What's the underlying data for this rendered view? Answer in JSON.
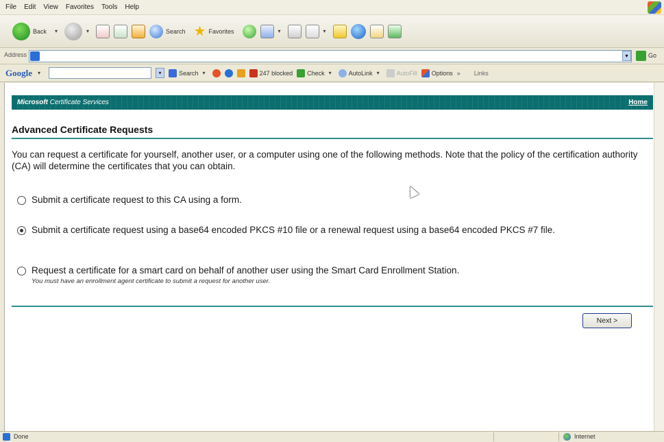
{
  "menu": [
    "File",
    "Edit",
    "View",
    "Favorites",
    "Tools",
    "Help"
  ],
  "toolbar": {
    "back_label": "Back",
    "search_label": "Search",
    "favorites_label": "Favorites"
  },
  "address": {
    "label": "Address",
    "value": "",
    "go_label": "Go"
  },
  "googlebar": {
    "logo": "Google",
    "search_label": "Search",
    "blocked_label": "247 blocked",
    "check_label": "Check",
    "autolink_label": "AutoLink",
    "autofill_label": "AutoFill",
    "options_label": "Options",
    "links_label": "Links"
  },
  "page": {
    "brand_bold": "Microsoft",
    "brand_rest": " Certificate Services",
    "home_link": "Home",
    "title": "Advanced Certificate Requests",
    "intro": "You can request a certificate for yourself, another user, or a computer using one of the following methods. Note that the policy of the certification authority (CA) will determine the certificates that you can obtain.",
    "options": [
      {
        "label": "Submit a certificate request to this CA using a form.",
        "checked": false
      },
      {
        "label": "Submit a certificate request using a base64 encoded PKCS #10 file or a renewal request using a base64 encoded PKCS #7 file.",
        "checked": true
      },
      {
        "label": "Request a certificate for a smart card on behalf of another user using the Smart Card Enrollment Station.",
        "note": "You must have an enrollment agent certificate to submit a request for another user.",
        "checked": false
      }
    ],
    "next_button": "Next >"
  },
  "status": {
    "text": "Done",
    "zone": "Internet"
  },
  "colors": {
    "header_teal": "#0c6e6e",
    "rule_teal": "#2f8f8f",
    "chrome": "#ece9d8"
  }
}
